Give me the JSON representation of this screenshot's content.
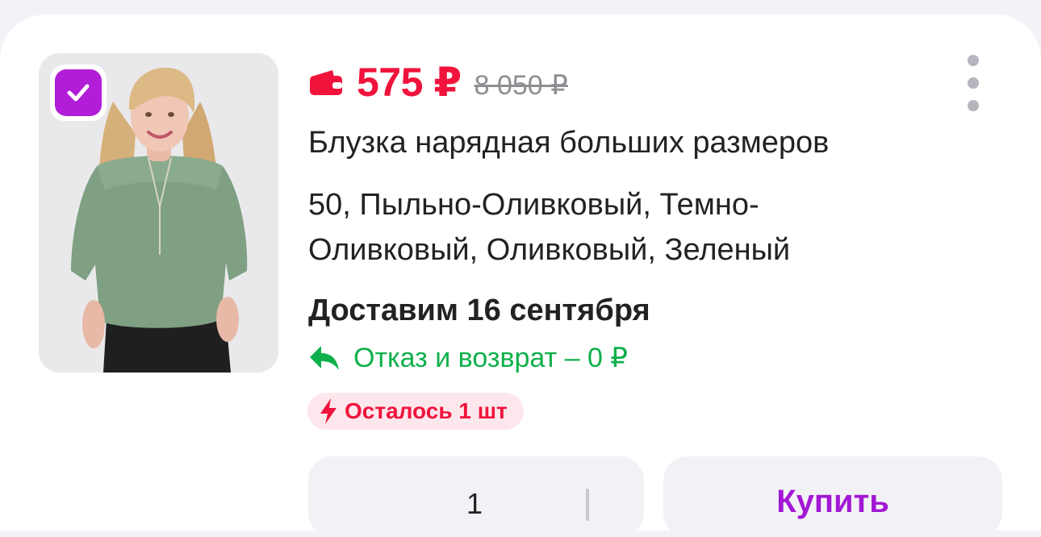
{
  "product": {
    "price": "575 ₽",
    "old_price": "8 050 ₽",
    "title": "Блузка нарядная больших размеров",
    "variant": "50, Пыльно-Оливковый, Темно-Оливковый, Оливковый, Зеленый",
    "delivery": "Доставим 16 сентября",
    "return_policy": "Отказ и возврат – 0 ₽",
    "stock_badge": "Осталось 1 шт",
    "selected": true
  },
  "quantity": {
    "value": "1"
  },
  "actions": {
    "buy_label": "Купить"
  },
  "icons": {
    "wallet": "wallet-icon",
    "menu": "more-vertical-icon",
    "check": "check-icon",
    "return": "return-arrow-icon",
    "stock": "lightning-icon"
  },
  "colors": {
    "price": "#f0133c",
    "return": "#0fb04b",
    "accent": "#b21dd8",
    "buy": "#a317d4",
    "badge_bg": "#fde7ec"
  }
}
